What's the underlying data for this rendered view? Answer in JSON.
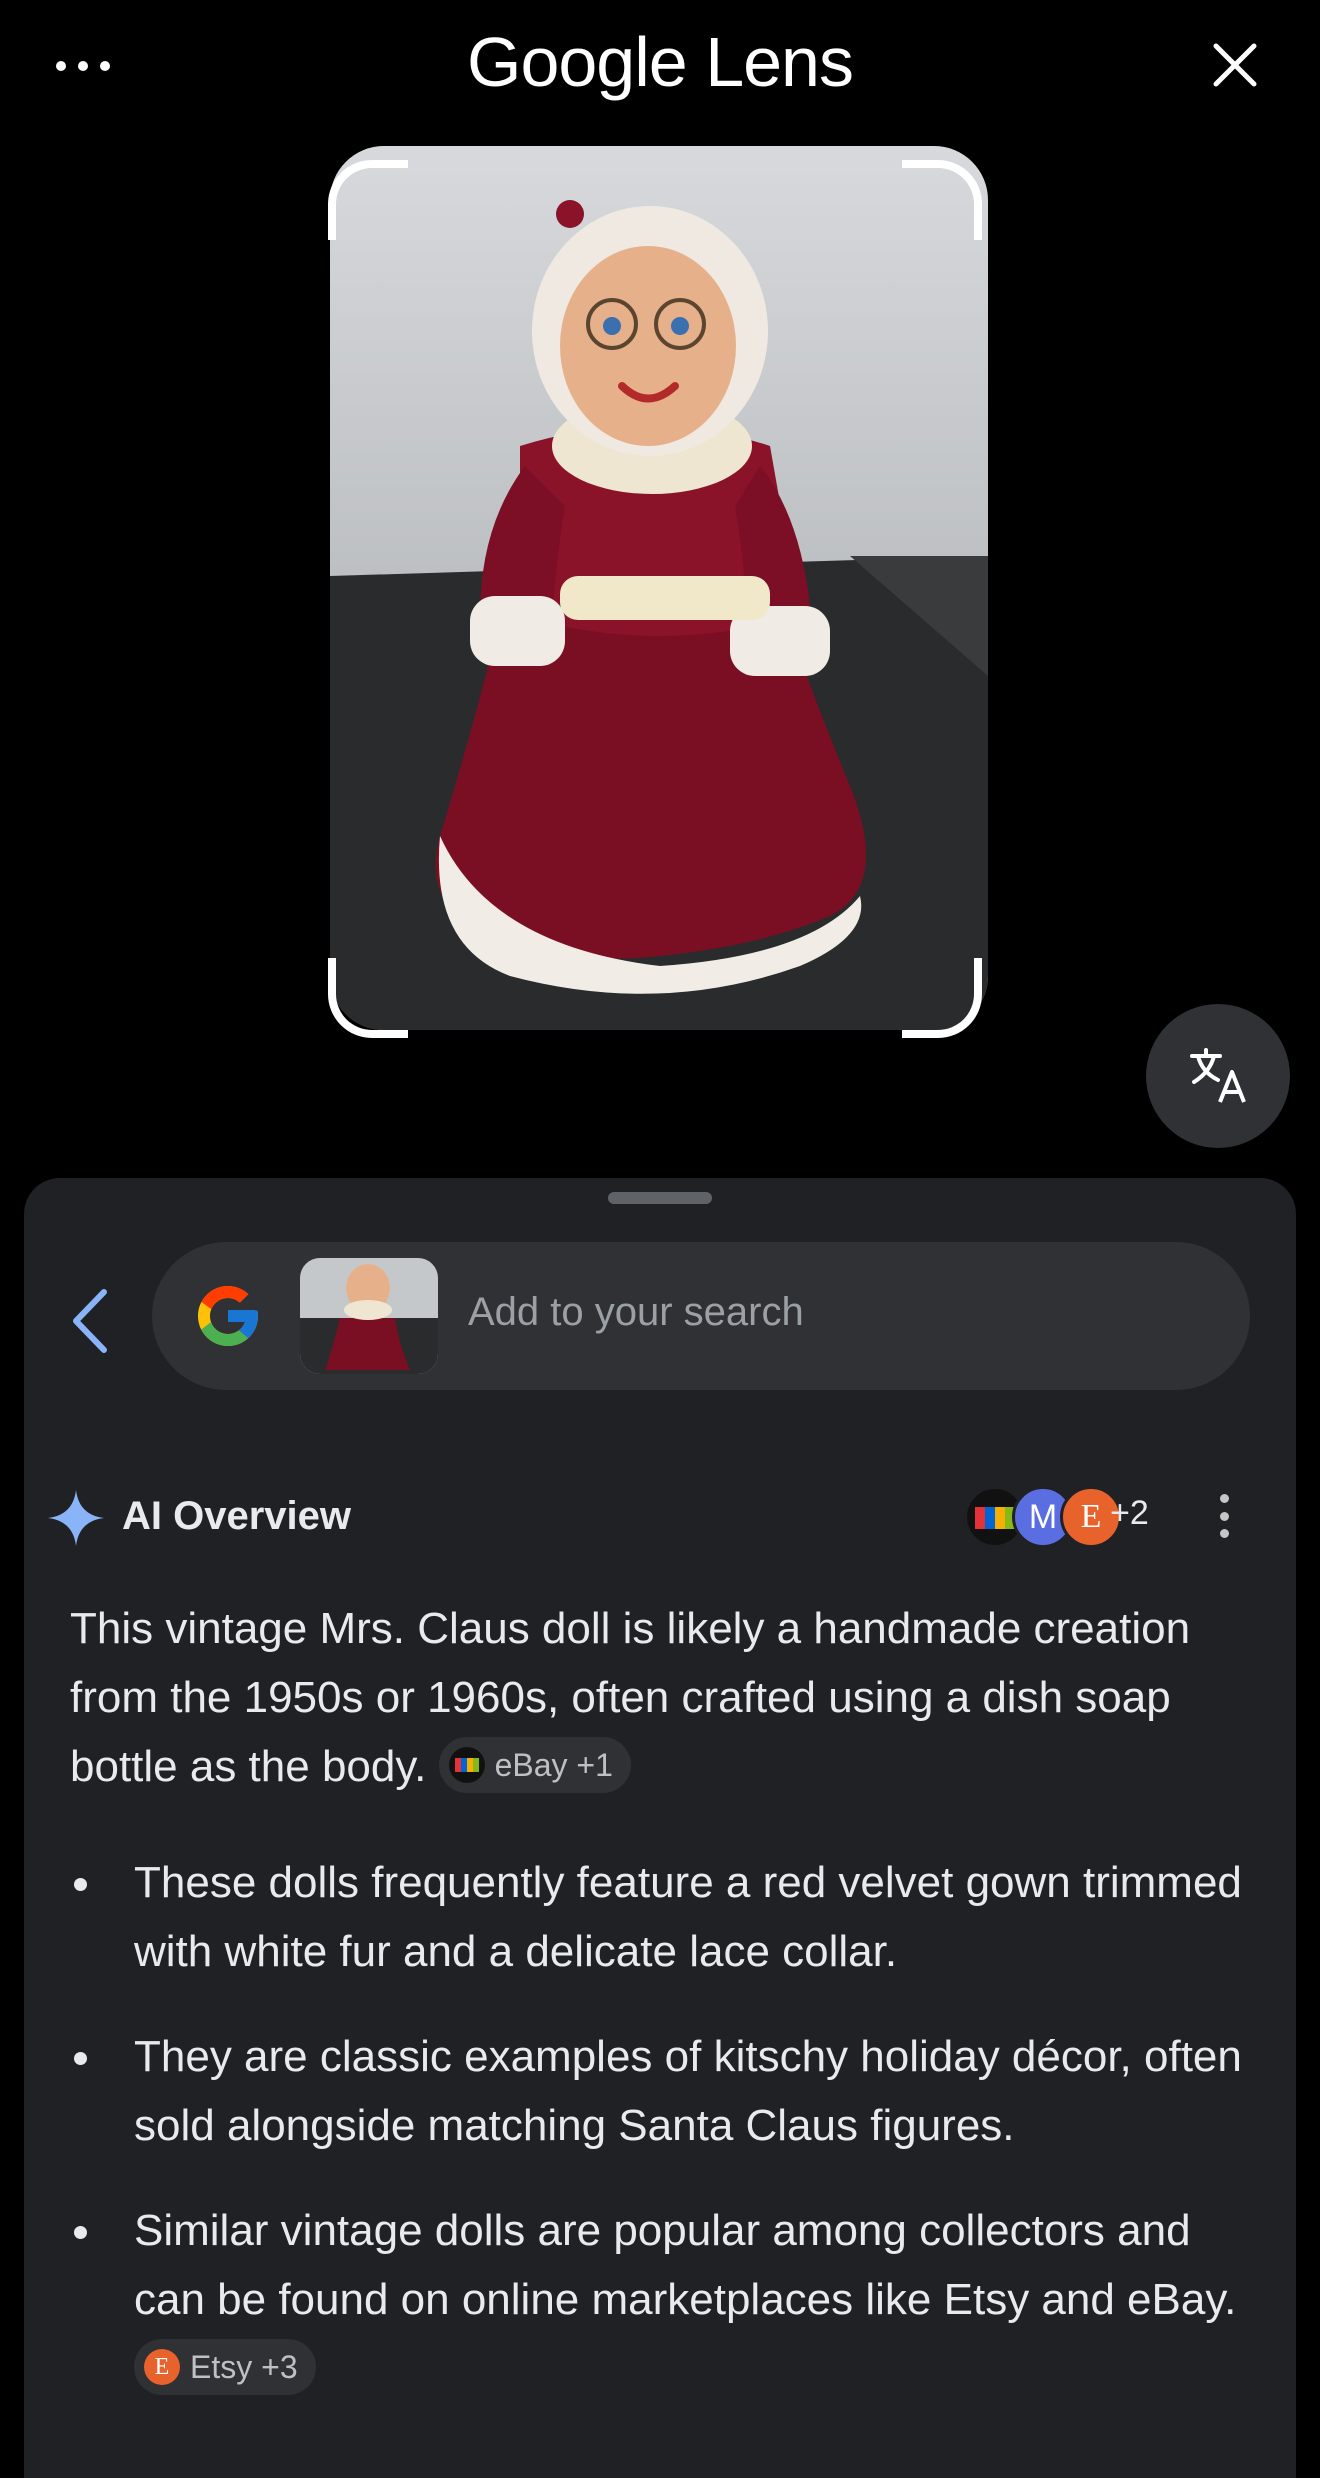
{
  "header": {
    "brand": "Google",
    "product": "Lens"
  },
  "search": {
    "placeholder": "Add to your search"
  },
  "ai_overview": {
    "title": "AI Overview",
    "sources_more": "+2",
    "summary": "This vintage Mrs. Claus doll is likely a handmade creation from the 1950s or 1960s, often crafted using a dish soap bottle as the body.",
    "summary_chip": "eBay +1",
    "bullets": [
      "These dolls frequently feature a red velvet gown trimmed with white fur and a delicate lace collar.",
      "They are classic examples of kitschy holiday décor, often sold alongside matching Santa Claus figures.",
      "Similar vintage dolls are popular among collectors and can be found on online marketplaces like Etsy and eBay."
    ],
    "bullet3_chip": "Etsy +3"
  },
  "colors": {
    "background": "#000000",
    "sheet": "#202124",
    "searchbar": "#303134",
    "accent_blue": "#8ab4f8",
    "etsy_orange": "#e8622c",
    "doll_red": "#7a0f24"
  }
}
